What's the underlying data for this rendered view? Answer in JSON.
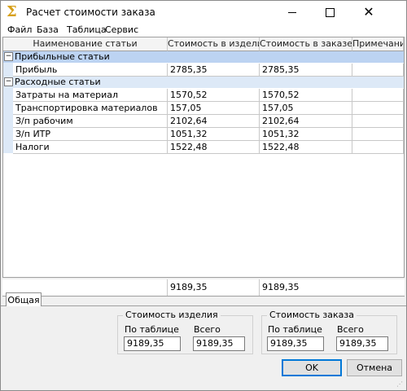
{
  "window": {
    "title": "Расчет стоимости заказа",
    "icon": "sigma-icon"
  },
  "menu": [
    "Файл",
    "База",
    "Таблица",
    "Сервис"
  ],
  "grid": {
    "columns": [
      "Наименование статьи",
      "Стоимость в изделии",
      "Стоимость в заказе",
      "Примечание"
    ],
    "groups": [
      {
        "name": "Прибыльные статьи",
        "rows": [
          {
            "name": "Прибыль",
            "item_cost": "2785,35",
            "order_cost": "2785,35",
            "note": ""
          }
        ]
      },
      {
        "name": "Расходные статьи",
        "rows": [
          {
            "name": "Затраты на материал",
            "item_cost": "1570,52",
            "order_cost": "1570,52",
            "note": ""
          },
          {
            "name": "Транспортировка материалов",
            "item_cost": "157,05",
            "order_cost": "157,05",
            "note": ""
          },
          {
            "name": "З/п рабочим",
            "item_cost": "2102,64",
            "order_cost": "2102,64",
            "note": ""
          },
          {
            "name": "З/п ИТР",
            "item_cost": "1051,32",
            "order_cost": "1051,32",
            "note": ""
          },
          {
            "name": "Налоги",
            "item_cost": "1522,48",
            "order_cost": "1522,48",
            "note": ""
          }
        ]
      }
    ],
    "totals": {
      "item_cost": "9189,35",
      "order_cost": "9189,35"
    },
    "colors": {
      "group_selected": "#bcd3f2",
      "group": "#dde9f7"
    }
  },
  "tabs": [
    "Общая"
  ],
  "item_cost_box": {
    "title": "Стоимость изделия",
    "by_table_label": "По таблице",
    "by_table_value": "9189,35",
    "total_label": "Всего",
    "total_value": "9189,35"
  },
  "order_cost_box": {
    "title": "Стоимость заказа",
    "by_table_label": "По таблице",
    "by_table_value": "9189,35",
    "total_label": "Всего",
    "total_value": "9189,35"
  },
  "buttons": {
    "ok": "OK",
    "cancel": "Отмена"
  }
}
